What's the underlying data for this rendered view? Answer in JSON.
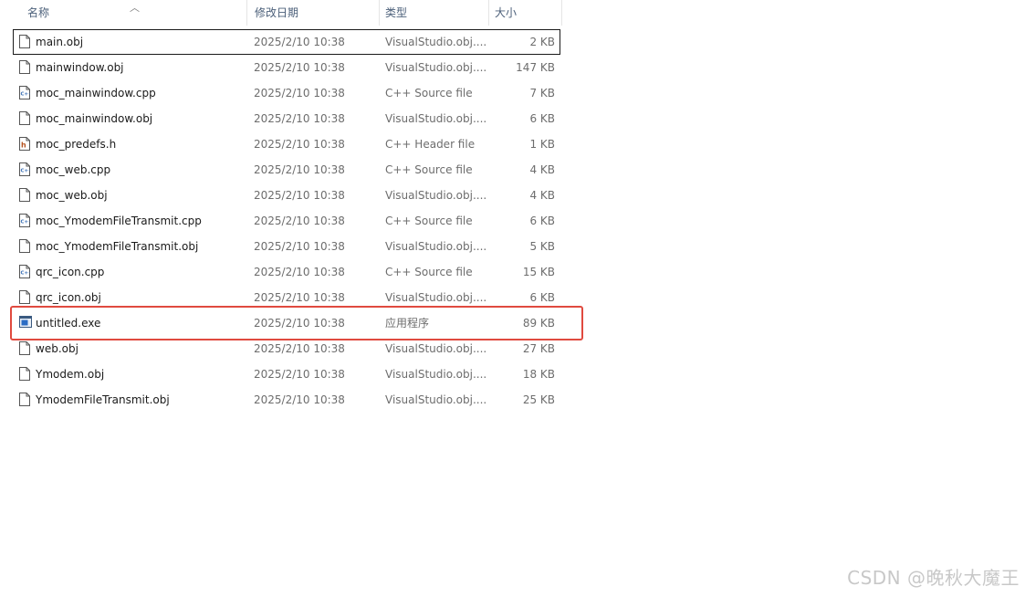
{
  "columns": {
    "name": "名称",
    "date": "修改日期",
    "type": "类型",
    "size": "大小"
  },
  "files": [
    {
      "name": "main.obj",
      "date": "2025/2/10 10:38",
      "type": "VisualStudio.obj....",
      "size": "2 KB",
      "icon": "blank-file-icon"
    },
    {
      "name": "mainwindow.obj",
      "date": "2025/2/10 10:38",
      "type": "VisualStudio.obj....",
      "size": "147 KB",
      "icon": "blank-file-icon"
    },
    {
      "name": "moc_mainwindow.cpp",
      "date": "2025/2/10 10:38",
      "type": "C++ Source file",
      "size": "7 KB",
      "icon": "cpp-file-icon"
    },
    {
      "name": "moc_mainwindow.obj",
      "date": "2025/2/10 10:38",
      "type": "VisualStudio.obj....",
      "size": "6 KB",
      "icon": "blank-file-icon"
    },
    {
      "name": "moc_predefs.h",
      "date": "2025/2/10 10:38",
      "type": "C++ Header file",
      "size": "1 KB",
      "icon": "header-file-icon"
    },
    {
      "name": "moc_web.cpp",
      "date": "2025/2/10 10:38",
      "type": "C++ Source file",
      "size": "4 KB",
      "icon": "cpp-file-icon"
    },
    {
      "name": "moc_web.obj",
      "date": "2025/2/10 10:38",
      "type": "VisualStudio.obj....",
      "size": "4 KB",
      "icon": "blank-file-icon"
    },
    {
      "name": "moc_YmodemFileTransmit.cpp",
      "date": "2025/2/10 10:38",
      "type": "C++ Source file",
      "size": "6 KB",
      "icon": "cpp-file-icon"
    },
    {
      "name": "moc_YmodemFileTransmit.obj",
      "date": "2025/2/10 10:38",
      "type": "VisualStudio.obj....",
      "size": "5 KB",
      "icon": "blank-file-icon"
    },
    {
      "name": "qrc_icon.cpp",
      "date": "2025/2/10 10:38",
      "type": "C++ Source file",
      "size": "15 KB",
      "icon": "cpp-file-icon"
    },
    {
      "name": "qrc_icon.obj",
      "date": "2025/2/10 10:38",
      "type": "VisualStudio.obj....",
      "size": "6 KB",
      "icon": "blank-file-icon"
    },
    {
      "name": "untitled.exe",
      "date": "2025/2/10 10:38",
      "type": "应用程序",
      "size": "89 KB",
      "icon": "exe-file-icon"
    },
    {
      "name": "web.obj",
      "date": "2025/2/10 10:38",
      "type": "VisualStudio.obj....",
      "size": "27 KB",
      "icon": "blank-file-icon"
    },
    {
      "name": "Ymodem.obj",
      "date": "2025/2/10 10:38",
      "type": "VisualStudio.obj....",
      "size": "18 KB",
      "icon": "blank-file-icon"
    },
    {
      "name": "YmodemFileTransmit.obj",
      "date": "2025/2/10 10:38",
      "type": "VisualStudio.obj....",
      "size": "25 KB",
      "icon": "blank-file-icon"
    }
  ],
  "watermark": "CSDN @晚秋大魔王",
  "colors": {
    "highlight": "#e04a3f",
    "header_text": "#4c607a"
  }
}
